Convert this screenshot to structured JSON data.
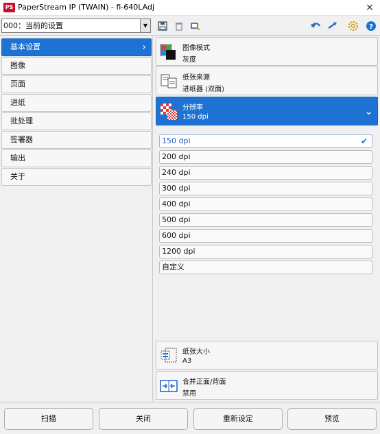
{
  "window": {
    "app_badge": "PS",
    "title": "PaperStream IP (TWAIN) - fi-640LAdj",
    "close_glyph": "×"
  },
  "toolbar": {
    "profile_value": "000：当前的设置"
  },
  "sidebar": {
    "items": [
      {
        "label": "基本设置"
      },
      {
        "label": "图像"
      },
      {
        "label": "页面"
      },
      {
        "label": "进纸"
      },
      {
        "label": "批处理"
      },
      {
        "label": "签署器"
      },
      {
        "label": "输出"
      },
      {
        "label": "关于"
      }
    ]
  },
  "settings": {
    "image_mode": {
      "title": "图像模式",
      "value": "灰度"
    },
    "paper_source": {
      "title": "纸张来源",
      "value": "进纸器 (双面)"
    },
    "resolution": {
      "title": "分辨率",
      "value": "150 dpi"
    },
    "paper_size": {
      "title": "纸张大小",
      "value": "A3"
    },
    "merge": {
      "title": "合并正面/背面",
      "value": "禁用"
    }
  },
  "resolution_options": [
    "150 dpi",
    "200 dpi",
    "240 dpi",
    "300 dpi",
    "400 dpi",
    "500 dpi",
    "600 dpi",
    "1200 dpi",
    "自定义"
  ],
  "resolution_selected": "150 dpi",
  "footer": {
    "scan": "扫描",
    "close": "关闭",
    "reset": "重新设定",
    "preview": "预览"
  },
  "colors": {
    "accent": "#1e72d3",
    "selected_text": "#1e5fc4",
    "badge_red": "#c8102e"
  }
}
